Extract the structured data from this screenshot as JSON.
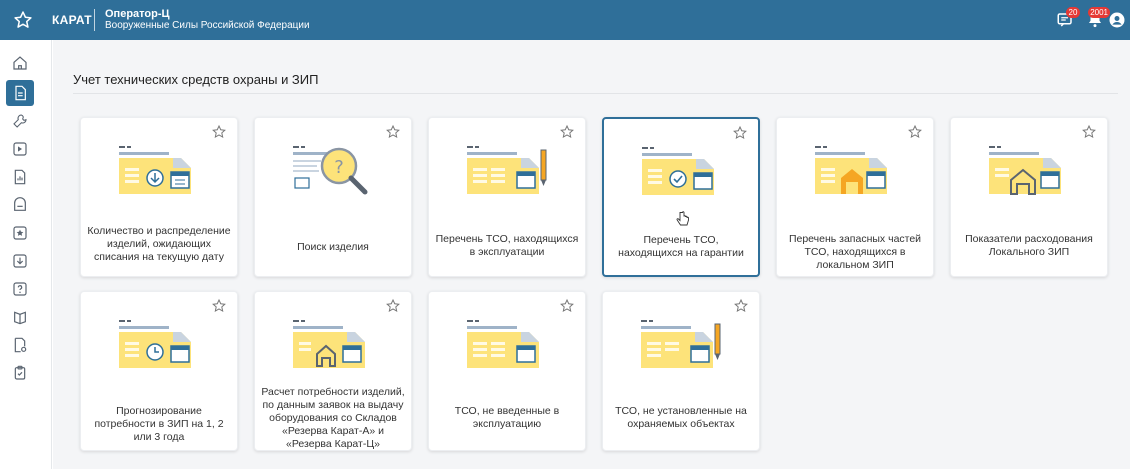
{
  "app": {
    "brand": "КАРАТ",
    "title": "Оператор-Ц",
    "subtitle": "Вооруженные Силы Российской Федерации"
  },
  "notifications": {
    "messages_count": "20",
    "alerts_count": "2001"
  },
  "section": {
    "title": "Учет технических средств охраны и ЗИП"
  },
  "cards": [
    {
      "label": "Количество и распределение изделий, ожидающих списания на текущую дату",
      "icon": "folder-download-icon"
    },
    {
      "label": "Поиск изделия",
      "icon": "search-document-icon"
    },
    {
      "label": "Перечень ТСО, находящихся в эксплуатации",
      "icon": "folder-pen-icon"
    },
    {
      "label": "Перечень ТСО, находящихся на гарантии",
      "icon": "folder-check-icon"
    },
    {
      "label": "Перечень запасных частей ТСО, находящихся в локальном ЗИП",
      "icon": "folder-warehouse-icon"
    },
    {
      "label": "Показатели расходования Локального ЗИП",
      "icon": "folder-house-icon"
    },
    {
      "label": "Прогнозирование потребности в ЗИП на 1, 2 или 3 года",
      "icon": "folder-clock-icon"
    },
    {
      "label": "Расчет потребности изделий, по данным заявок на выдачу оборудования со Складов «Резерва Карат-А» и «Резерва Карат-Ц»",
      "icon": "folder-house-calc-icon"
    },
    {
      "label": "ТСО, не введенные в эксплуатацию",
      "icon": "folder-calc-icon"
    },
    {
      "label": "ТСО, не установленные на охраняемых объектах",
      "icon": "folder-pen-icon"
    }
  ],
  "sidebar_icons": [
    "home-icon",
    "document-icon",
    "wrench-icon",
    "arrow-box-icon",
    "file-chart-icon",
    "archive-icon",
    "star-box-icon",
    "download-icon",
    "help-icon",
    "book-icon",
    "file-settings-icon",
    "clipboard-icon"
  ],
  "colors": {
    "topbar": "#2f6f99",
    "accent": "#2f6f99",
    "folder": "#fde37a",
    "badge": "#e53935"
  }
}
